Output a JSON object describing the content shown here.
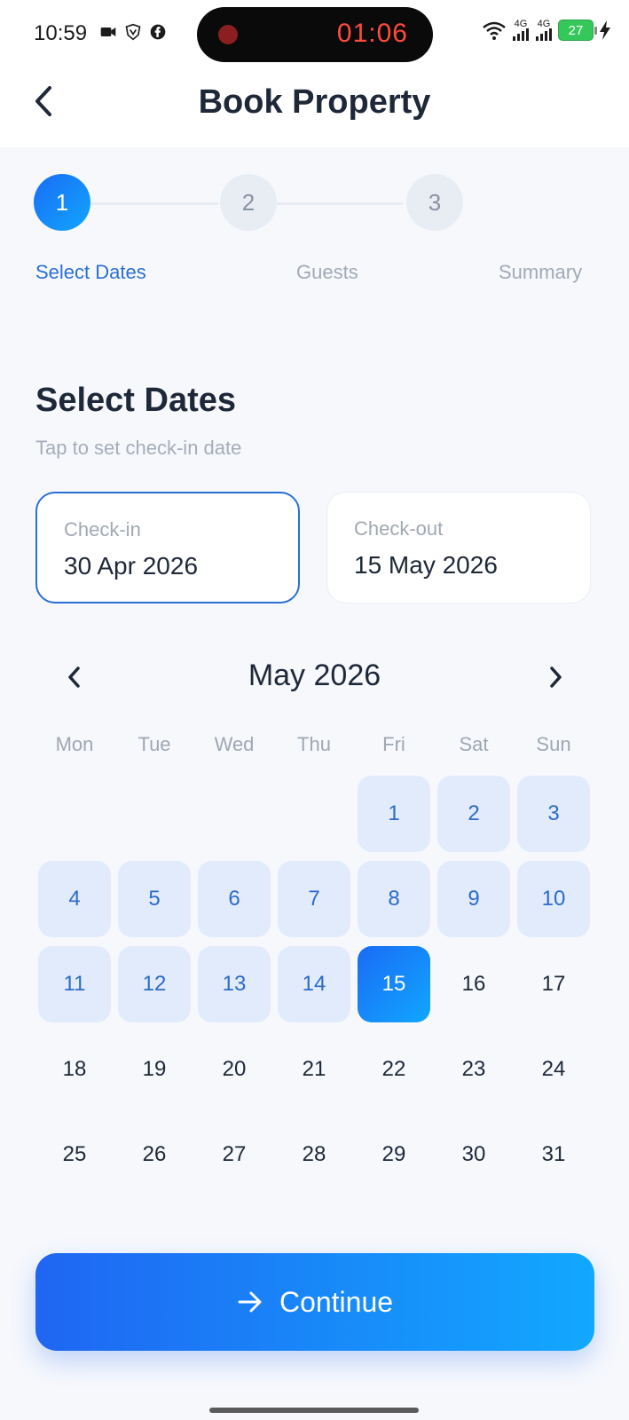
{
  "status_bar": {
    "time": "10:59",
    "recording_timer": "01:06",
    "network_1": "4G",
    "network_2": "4G",
    "battery": "27"
  },
  "header": {
    "title": "Book Property"
  },
  "stepper": {
    "steps": [
      {
        "number": "1",
        "label": "Select Dates",
        "active": true
      },
      {
        "number": "2",
        "label": "Guests",
        "active": false
      },
      {
        "number": "3",
        "label": "Summary",
        "active": false
      }
    ]
  },
  "section": {
    "title": "Select Dates",
    "subtitle": "Tap to set check-in date"
  },
  "checkin": {
    "label": "Check-in",
    "value": "30 Apr 2026"
  },
  "checkout": {
    "label": "Check-out",
    "value": "15 May 2026"
  },
  "calendar": {
    "month_title": "May 2026",
    "weekdays": [
      "Mon",
      "Tue",
      "Wed",
      "Thu",
      "Fri",
      "Sat",
      "Sun"
    ],
    "first_weekday_index": 4,
    "days_in_month": 31,
    "range_end_day": 15,
    "selected_day": 15
  },
  "continue_button": {
    "label": "Continue"
  },
  "colors": {
    "accent": "#1a6cf5",
    "accent_light": "#e1ebfb",
    "range_text": "#2c6cc9"
  }
}
